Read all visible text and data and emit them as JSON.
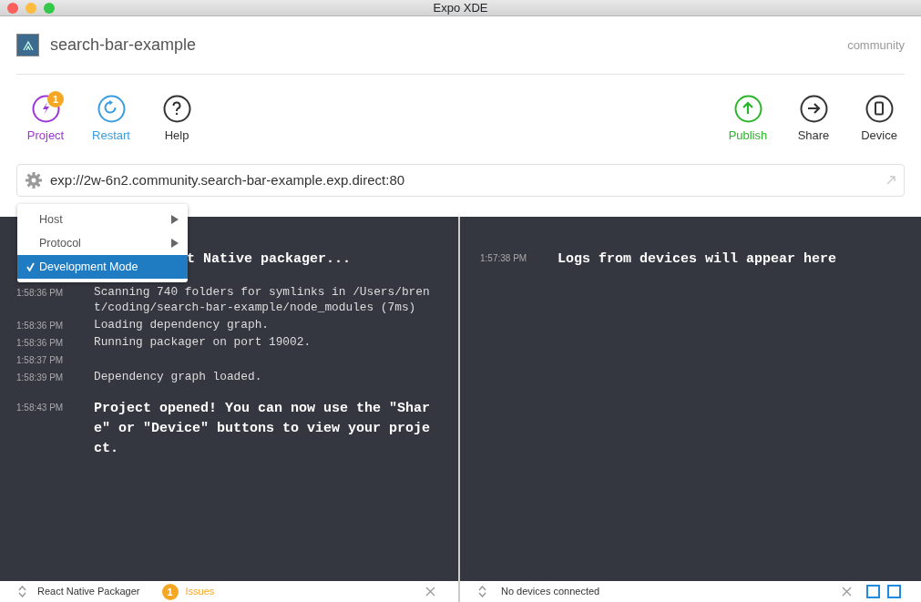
{
  "window": {
    "title": "Expo XDE"
  },
  "project": {
    "name": "search-bar-example",
    "owner": "community"
  },
  "toolbar_left": [
    {
      "label": "Project",
      "color": "#9b37d6",
      "badge": "1"
    },
    {
      "label": "Restart",
      "color": "#3b9de0"
    },
    {
      "label": "Help",
      "color": "#333333"
    }
  ],
  "toolbar_right": [
    {
      "label": "Publish",
      "color": "#2bb52b"
    },
    {
      "label": "Share",
      "color": "#333333"
    },
    {
      "label": "Device",
      "color": "#333333"
    }
  ],
  "url_bar": {
    "value": "exp://2w-6n2.community.search-bar-example.exp.direct:80"
  },
  "menu": [
    {
      "label": "Host",
      "submenu": true,
      "checked": false,
      "selected": false
    },
    {
      "label": "Protocol",
      "submenu": true,
      "checked": false,
      "selected": false
    },
    {
      "label": "Development Mode",
      "submenu": false,
      "checked": true,
      "selected": true
    }
  ],
  "packager_log": [
    {
      "message": "t Native packager...",
      "kind": "emphasis"
    },
    {
      "time": "1:58:36 PM",
      "message": "Scanning 740 folders for symlinks in /Users/brent/coding/search-bar-example/node_modules (7ms)",
      "kind": "normal"
    },
    {
      "time": "1:58:36 PM",
      "message": "Loading dependency graph.",
      "kind": "normal"
    },
    {
      "time": "1:58:36 PM",
      "message": "Running packager on port 19002.",
      "kind": "normal"
    },
    {
      "time": "1:58:37 PM",
      "kind": "normal"
    },
    {
      "time": "1:58:39 PM",
      "message": "Dependency graph loaded.",
      "kind": "normal"
    },
    {
      "time": "1:58:43 PM",
      "message": "Project opened! You can now use the \"Share\" or \"Device\" buttons to view your project.",
      "kind": "emphasis"
    }
  ],
  "device_log": [
    {
      "time": "1:57:38 PM",
      "message": "Logs from devices will appear here",
      "kind": "emphasis"
    }
  ],
  "status_left": {
    "title": "React Native Packager",
    "issues_count": "1",
    "issues_label": "Issues"
  },
  "status_right": {
    "title": "No devices connected"
  }
}
